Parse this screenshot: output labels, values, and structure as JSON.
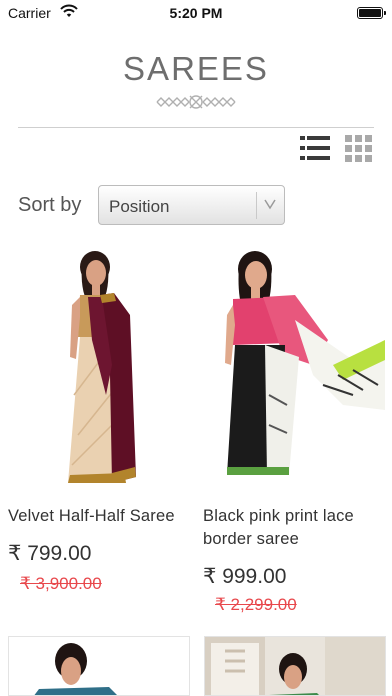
{
  "status_bar": {
    "carrier": "Carrier",
    "time": "5:20 PM"
  },
  "page": {
    "title": "SAREES"
  },
  "sort": {
    "label": "Sort by",
    "selected": "Position"
  },
  "products": [
    {
      "name": "Velvet Half-Half Saree",
      "price": "₹ 799.00",
      "old_price": "₹ 3,900.00"
    },
    {
      "name": "Black pink print lace border saree",
      "price": "₹ 999.00",
      "old_price": "₹ 2,299.00"
    }
  ],
  "icons": {
    "list_view": "list-view-icon",
    "grid_view": "grid-view-icon",
    "dropdown": "chevron-down-icon",
    "wifi": "wifi-icon",
    "battery": "battery-icon"
  },
  "colors": {
    "old_price": "#e8484c",
    "title": "#6e6e6e"
  }
}
